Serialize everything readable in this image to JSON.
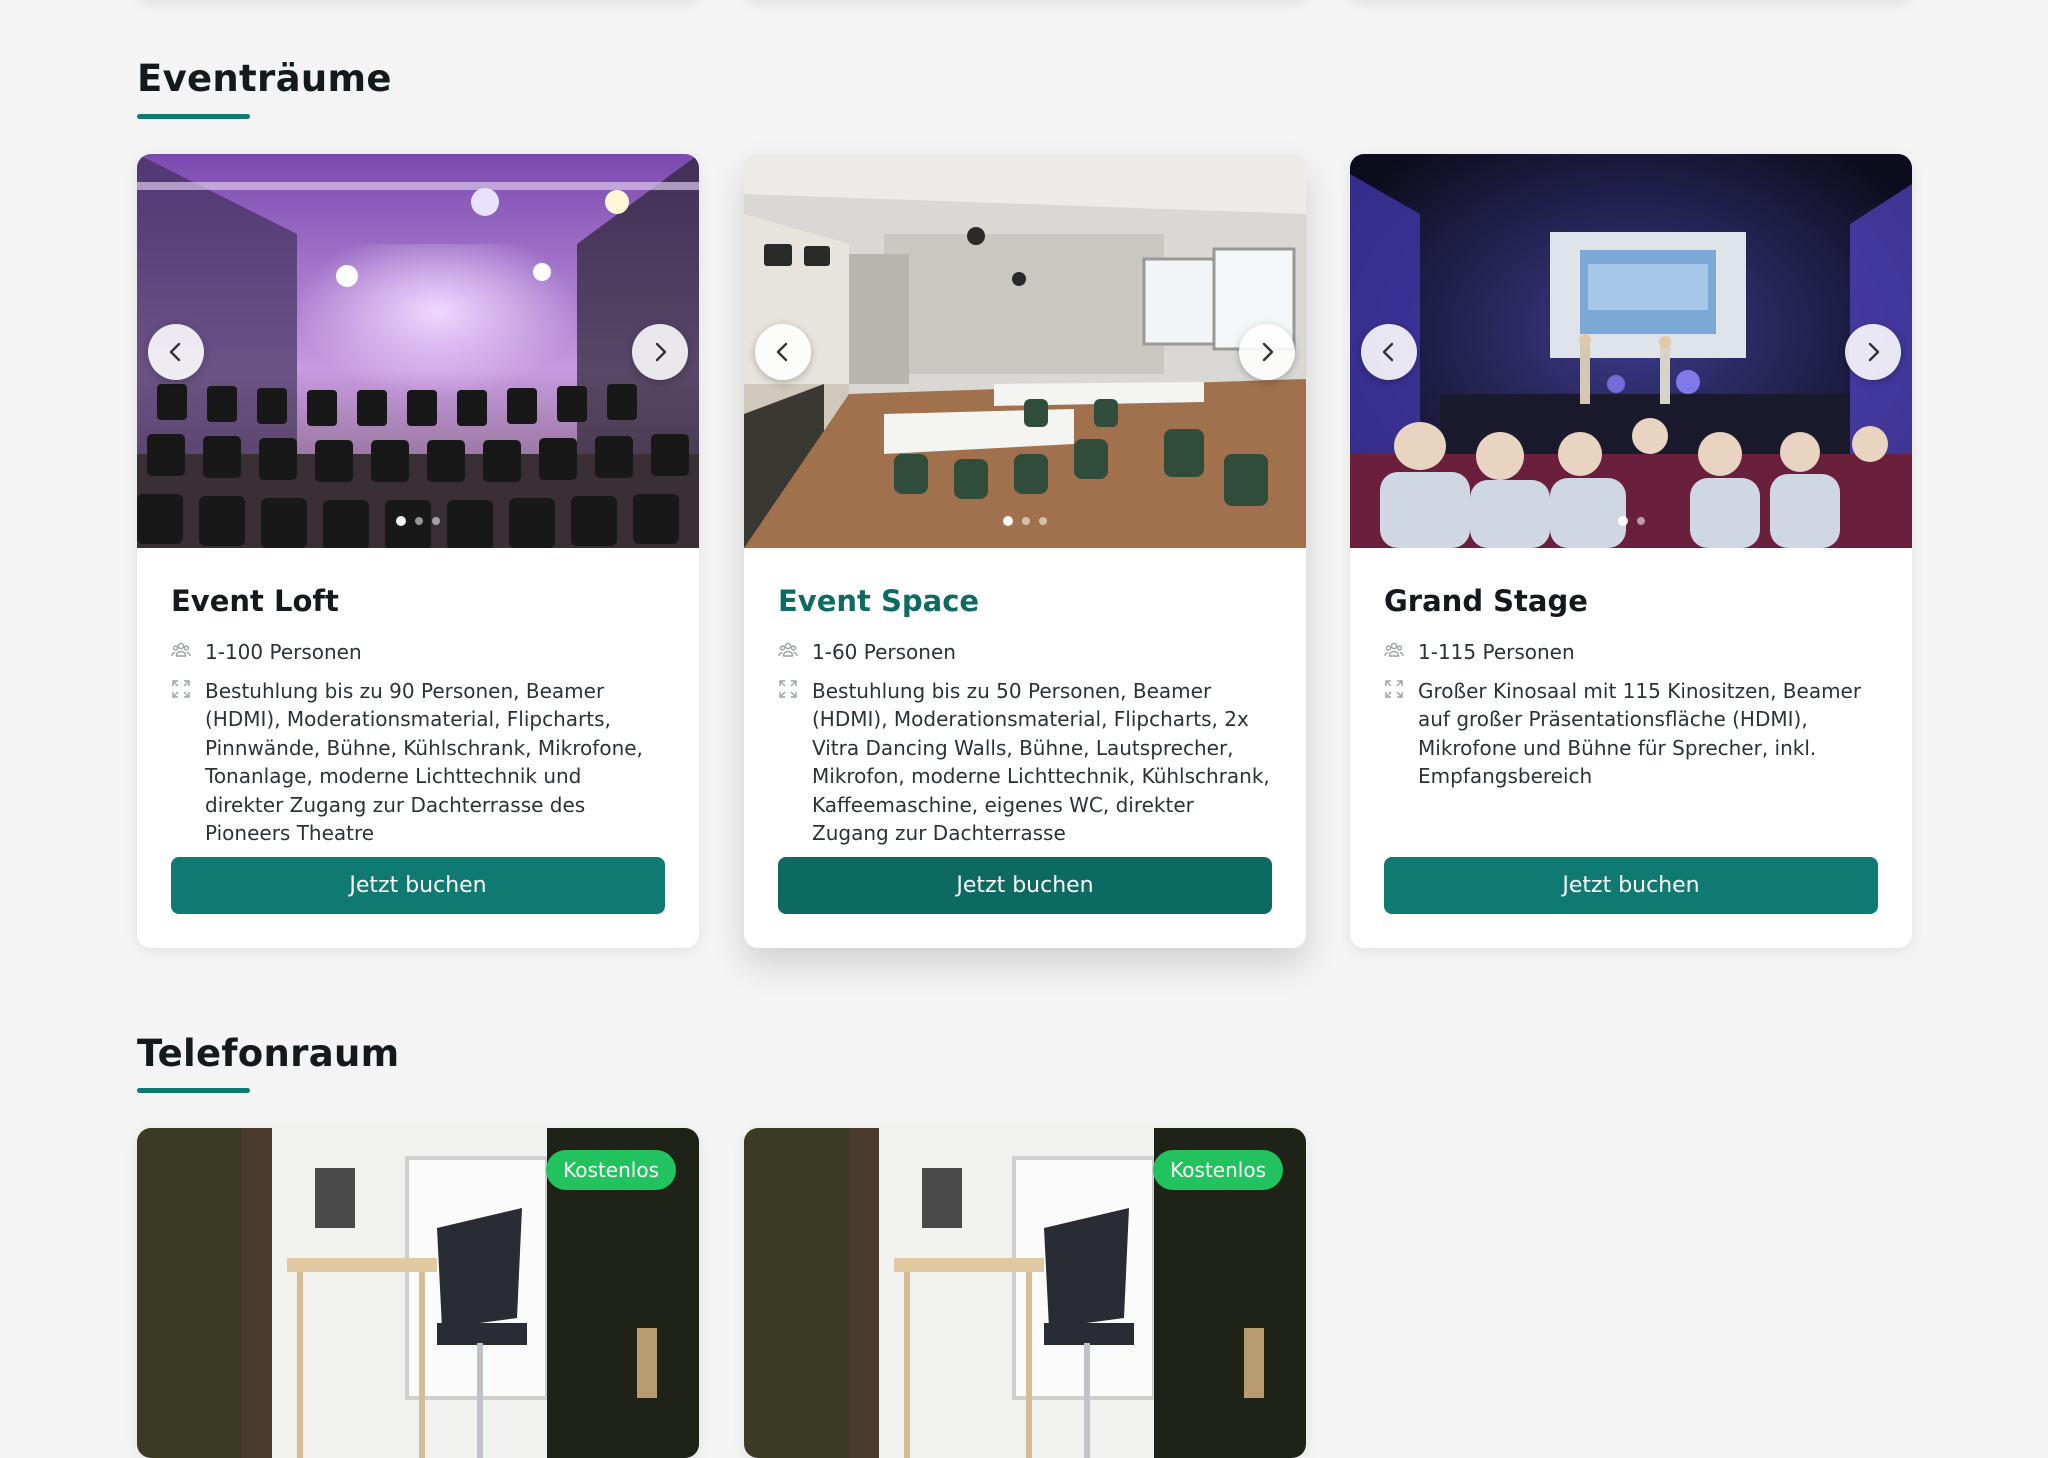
{
  "sections": {
    "event": {
      "title": "Eventräume",
      "cards": [
        {
          "title": "Event Loft",
          "capacity": "1-100 Personen",
          "description": "Bestuhlung bis zu 90 Personen, Beamer (HDMI), Moderationsmaterial, Flipcharts, Pinnwände, Bühne, Kühlschrank, Mikrofone, Tonanlage, moderne Lichttechnik und direkter Zugang zur Dachterrasse des Pioneers Theatre",
          "button": "Jetzt buchen",
          "image": "event-loft-photo"
        },
        {
          "title": "Event Space",
          "capacity": "1-60 Personen",
          "description": "Bestuhlung bis zu 50 Personen, Beamer (HDMI), Moderationsmaterial, Flipcharts, 2x Vitra Dancing Walls, Bühne, Lautsprecher, Mikrofon, moderne Lichttechnik, Kühlschrank, Kaffeemaschine, eigenes WC, direkter Zugang zur Dachterrasse",
          "button": "Jetzt buchen",
          "image": "event-space-photo"
        },
        {
          "title": "Grand Stage",
          "capacity": "1-115 Personen",
          "description": "Großer Kinosaal mit 115 Kinositzen, Beamer auf großer Präsentationsfläche (HDMI), Mikrofone und Bühne für Sprecher, inkl. Empfangsbereich",
          "button": "Jetzt buchen",
          "image": "grand-stage-photo"
        }
      ]
    },
    "phone": {
      "title": "Telefonraum",
      "cards": [
        {
          "badge": "Kostenlos",
          "image": "phone-booth-photo"
        },
        {
          "badge": "Kostenlos",
          "image": "phone-booth-photo"
        }
      ]
    }
  },
  "icons": {
    "capacity": "people-icon",
    "description": "expand-icon",
    "prev": "chevron-left-icon",
    "next": "chevron-right-icon"
  },
  "colors": {
    "accent": "#0e7a72",
    "accent_hover": "#0c6a63",
    "badge": "#22c35e",
    "background": "#f4f4f4"
  }
}
